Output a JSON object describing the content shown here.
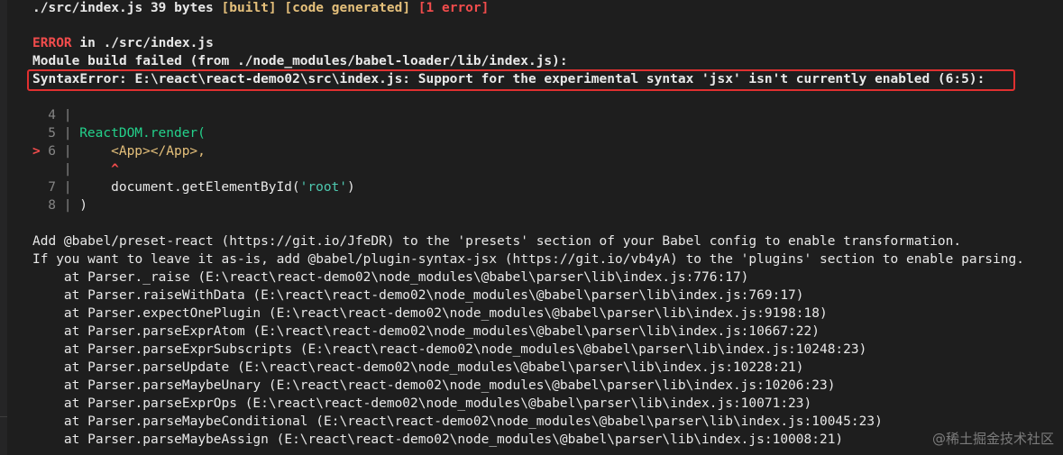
{
  "header": {
    "file": "./src/index.js",
    "size": "39 bytes",
    "built": "[built]",
    "code_generated": "[code generated]",
    "errors": "[1 error]"
  },
  "error": {
    "label": "ERROR",
    "in_text": " in ",
    "file": "./src/index.js",
    "module_build_failed": "Module build failed (from ./node_modules/babel-loader/lib/index.js):",
    "syntax_error": "SyntaxError: E:\\react\\react-demo02\\src\\index.js: Support for the experimental syntax 'jsx' isn't currently enabled (6:5):"
  },
  "code_frame": {
    "lines": [
      {
        "num": "4",
        "code": ""
      },
      {
        "num": "5",
        "code": "ReactDOM.render("
      },
      {
        "num": "6",
        "code": "    <App></App>,",
        "marker": ">"
      },
      {
        "num": "",
        "code": "    ^"
      },
      {
        "num": "7",
        "code_pre": "    document.getElementById(",
        "code_str": "'root'",
        "code_post": ")"
      },
      {
        "num": "8",
        "code": ")"
      }
    ]
  },
  "hints": [
    "Add @babel/preset-react (https://git.io/JfeDR) to the 'presets' section of your Babel config to enable transformation.",
    "If you want to leave it as-is, add @babel/plugin-syntax-jsx (https://git.io/vb4yA) to the 'plugins' section to enable parsing."
  ],
  "stack": [
    "    at Parser._raise (E:\\react\\react-demo02\\node_modules\\@babel\\parser\\lib\\index.js:776:17)",
    "    at Parser.raiseWithData (E:\\react\\react-demo02\\node_modules\\@babel\\parser\\lib\\index.js:769:17)",
    "    at Parser.expectOnePlugin (E:\\react\\react-demo02\\node_modules\\@babel\\parser\\lib\\index.js:9198:18)",
    "    at Parser.parseExprAtom (E:\\react\\react-demo02\\node_modules\\@babel\\parser\\lib\\index.js:10667:22)",
    "    at Parser.parseExprSubscripts (E:\\react\\react-demo02\\node_modules\\@babel\\parser\\lib\\index.js:10248:23)",
    "    at Parser.parseUpdate (E:\\react\\react-demo02\\node_modules\\@babel\\parser\\lib\\index.js:10228:21)",
    "    at Parser.parseMaybeUnary (E:\\react\\react-demo02\\node_modules\\@babel\\parser\\lib\\index.js:10206:23)",
    "    at Parser.parseExprOps (E:\\react\\react-demo02\\node_modules\\@babel\\parser\\lib\\index.js:10071:23)",
    "    at Parser.parseMaybeConditional (E:\\react\\react-demo02\\node_modules\\@babel\\parser\\lib\\index.js:10045:23)",
    "    at Parser.parseMaybeAssign (E:\\react\\react-demo02\\node_modules\\@babel\\parser\\lib\\index.js:10008:21)"
  ],
  "watermark": "@稀土掘金技术社区",
  "colors": {
    "background": "#1e1e1e",
    "error_red": "#f14c4c",
    "built_yellow": "#e5c07b",
    "code_green": "#23d18b",
    "highlight_border": "#e03030"
  }
}
